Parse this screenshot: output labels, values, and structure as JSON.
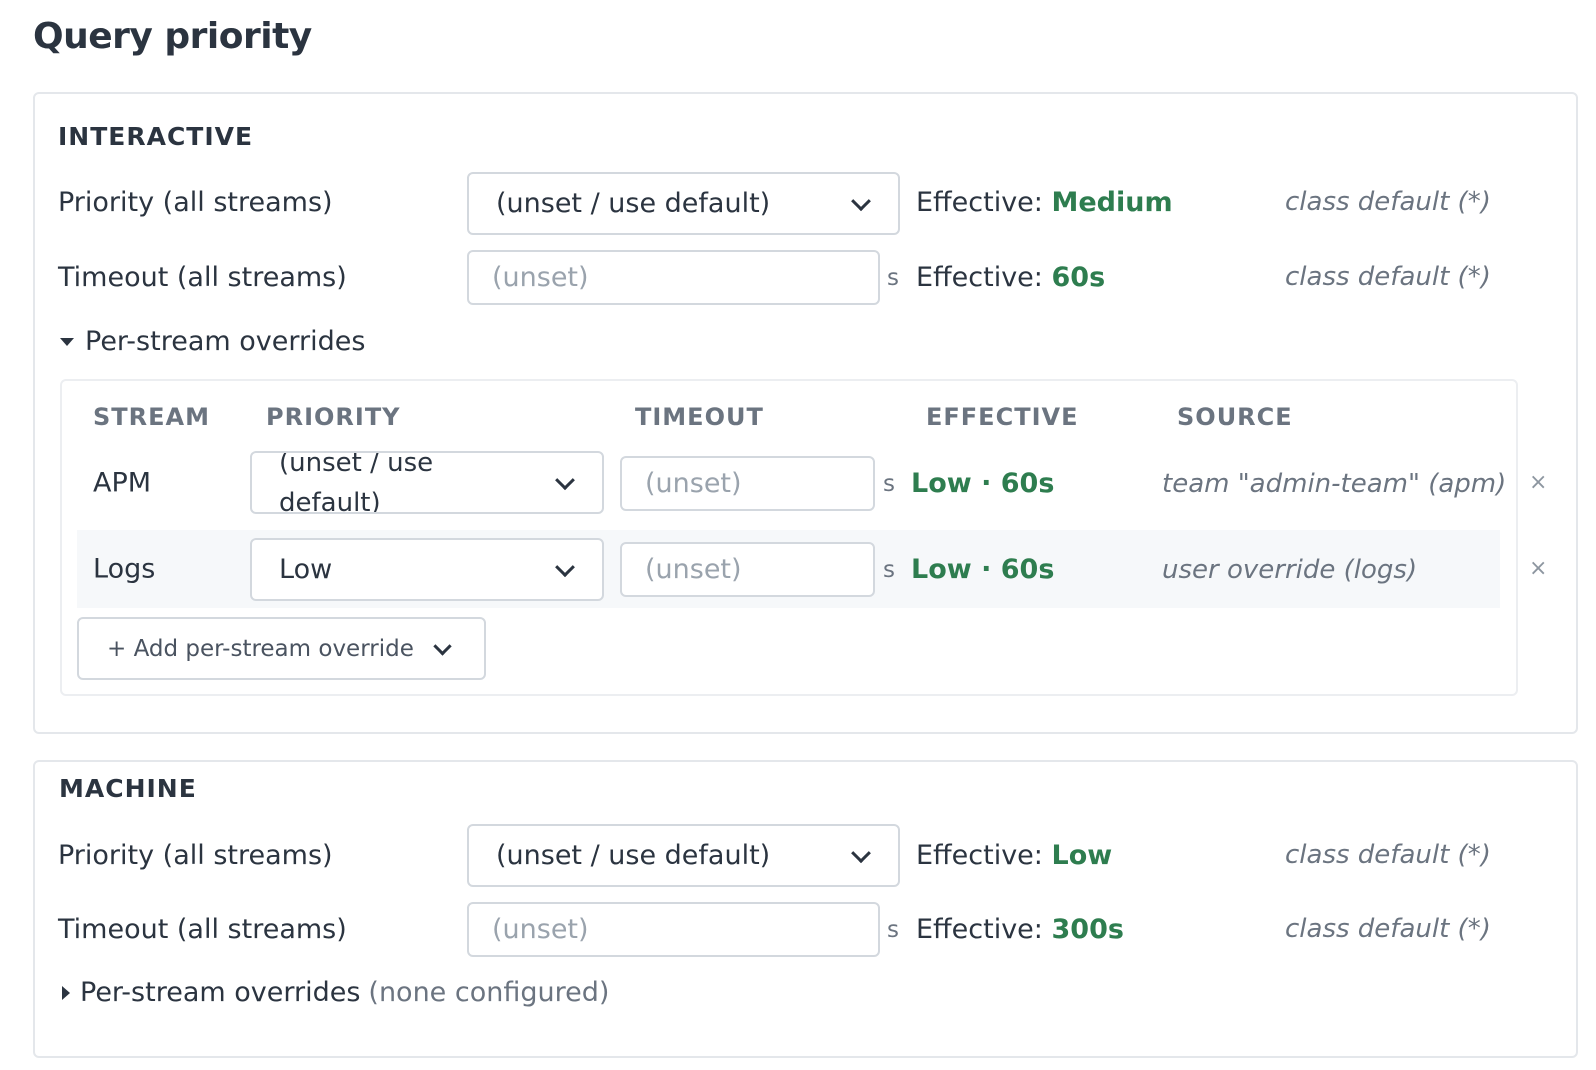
{
  "page": {
    "title": "Query priority"
  },
  "interactive": {
    "heading": "INTERACTIVE",
    "priority": {
      "label": "Priority (all streams)",
      "value": "(unset / use default)",
      "effective_label": "Effective:",
      "effective_value": "Medium",
      "source": "class default (*)"
    },
    "timeout": {
      "label": "Timeout (all streams)",
      "placeholder": "(unset)",
      "unit": "s",
      "effective_label": "Effective:",
      "effective_value": "60s",
      "source": "class default (*)"
    },
    "overrides_toggle": "Per-stream overrides",
    "table": {
      "headers": [
        "STREAM",
        "PRIORITY",
        "TIMEOUT",
        "EFFECTIVE",
        "SOURCE"
      ],
      "rows": [
        {
          "stream": "APM",
          "priority": "(unset / use default)",
          "timeout_placeholder": "(unset)",
          "unit": "s",
          "effective": "Low · 60s",
          "source": "team \"admin-team\" (apm)",
          "remove": "×"
        },
        {
          "stream": "Logs",
          "priority": "Low",
          "timeout_placeholder": "(unset)",
          "unit": "s",
          "effective": "Low · 60s",
          "source": "user override (logs)",
          "remove": "×"
        }
      ],
      "add_label": "+ Add per-stream override"
    }
  },
  "machine": {
    "heading": "MACHINE",
    "priority": {
      "label": "Priority (all streams)",
      "value": "(unset / use default)",
      "effective_label": "Effective:",
      "effective_value": "Low",
      "source": "class default (*)"
    },
    "timeout": {
      "label": "Timeout (all streams)",
      "placeholder": "(unset)",
      "unit": "s",
      "effective_label": "Effective:",
      "effective_value": "300s",
      "source": "class default (*)"
    },
    "overrides_toggle": "Per-stream overrides",
    "overrides_note": "(none configured)"
  },
  "colors": {
    "effective": "#2e7d4f",
    "muted": "#6b7480",
    "border": "#d3d8de"
  }
}
